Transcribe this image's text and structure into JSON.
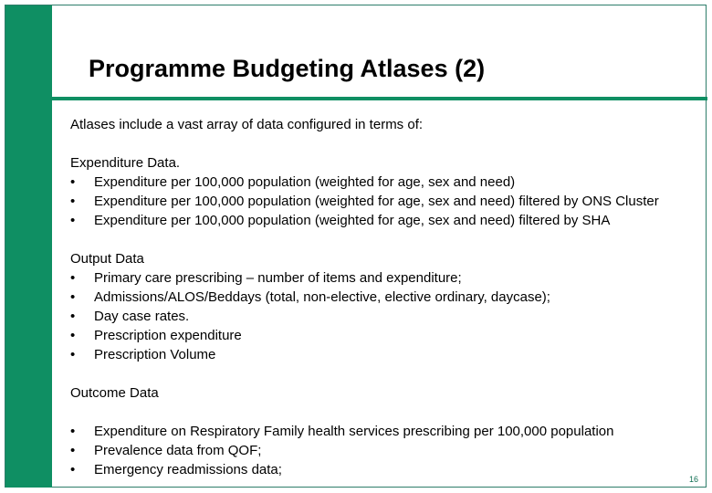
{
  "colors": {
    "accent_green": "#0f8f63",
    "frame_border": "#2e7d6a",
    "page_number": "#0f6e52"
  },
  "slide": {
    "title": "Programme Budgeting Atlases (2)",
    "intro": "Atlases include a vast array of data configured in terms of:",
    "sections": [
      {
        "heading": "Expenditure Data",
        "heading_suffix": ".",
        "items": [
          "Expenditure per 100,000 population (weighted for age, sex and need)",
          "Expenditure per 100,000 population (weighted for age, sex and need) filtered by ONS Cluster",
          "Expenditure per 100,000 population (weighted for age, sex and need) filtered by SHA"
        ]
      },
      {
        "heading": "Output Data",
        "heading_suffix": "",
        "items": [
          "Primary care prescribing – number of items and expenditure;",
          "Admissions/ALOS/Beddays (total, non-elective, elective ordinary, daycase);",
          "Day case rates.",
          "Prescription expenditure",
          "Prescription Volume"
        ]
      },
      {
        "heading": "Outcome Data",
        "heading_suffix": "",
        "items": [
          "Expenditure on Respiratory Family health services prescribing per 100,000 population",
          "Prevalence data from QOF;",
          "Emergency readmissions data;"
        ]
      }
    ],
    "bullet_glyph": "•",
    "page_number": "16"
  }
}
